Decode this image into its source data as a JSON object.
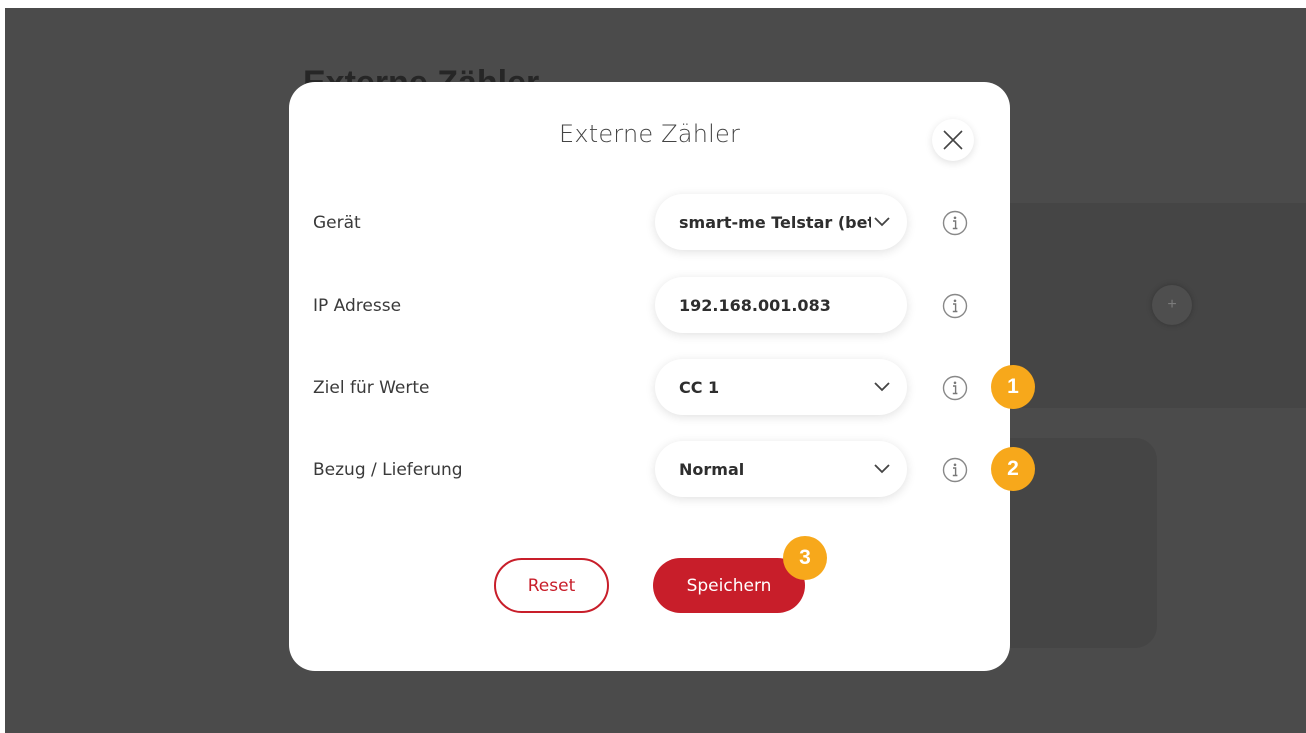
{
  "background": {
    "page_title": "Externe Zähler",
    "plus_label": "+"
  },
  "modal": {
    "title": "Externe Zähler",
    "close_icon": "close-icon",
    "rows": [
      {
        "label": "Gerät",
        "value": "smart-me Telstar (beta)",
        "type": "select"
      },
      {
        "label": "IP Adresse",
        "value": "192.168.001.083",
        "type": "input"
      },
      {
        "label": "Ziel für Werte",
        "value": "CC 1",
        "type": "select"
      },
      {
        "label": "Bezug / Lieferung",
        "value": "Normal",
        "type": "select"
      }
    ],
    "reset_label": "Reset",
    "save_label": "Speichern"
  },
  "badges": [
    "1",
    "2",
    "3"
  ],
  "colors": {
    "accent": "#c81e2a",
    "badge": "#f7a81b",
    "overlay": "#4b4b4b"
  }
}
